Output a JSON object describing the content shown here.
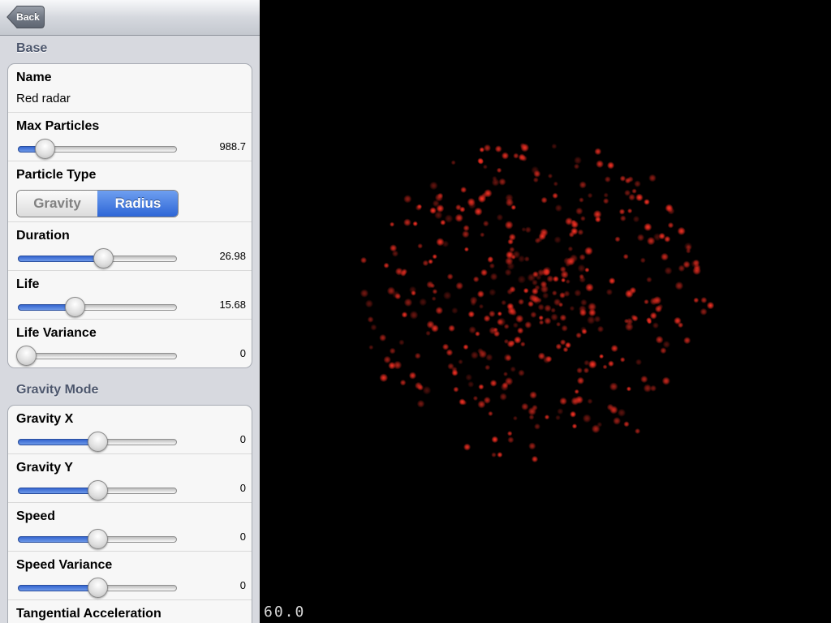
{
  "nav": {
    "back_label": "Back"
  },
  "sections": [
    {
      "title": "Base"
    },
    {
      "title": "Gravity Mode"
    }
  ],
  "base": {
    "name": {
      "label": "Name",
      "value": "Red radar"
    },
    "max_particles": {
      "label": "Max Particles",
      "value": "988.7",
      "fraction": 0.13
    },
    "particle_type": {
      "label": "Particle Type",
      "options": [
        "Gravity",
        "Radius"
      ],
      "selected": "Radius"
    },
    "duration": {
      "label": "Duration",
      "value": "26.98",
      "fraction": 0.54
    },
    "life": {
      "label": "Life",
      "value": "15.68",
      "fraction": 0.34
    },
    "life_variance": {
      "label": "Life Variance",
      "value": "0",
      "fraction": 0.0
    }
  },
  "gravity_mode": {
    "gravity_x": {
      "label": "Gravity X",
      "value": "0",
      "fraction": 0.5
    },
    "gravity_y": {
      "label": "Gravity Y",
      "value": "0",
      "fraction": 0.5
    },
    "speed": {
      "label": "Speed",
      "value": "0",
      "fraction": 0.5
    },
    "speed_variance": {
      "label": "Speed Variance",
      "value": "0",
      "fraction": 0.5
    },
    "tangential_acceleration": {
      "label": "Tangential Acceleration"
    }
  },
  "preview": {
    "fps": "60.0",
    "particle_color": "#e0291e",
    "background": "#000000"
  },
  "colors": {
    "accent": "#3a6fd8",
    "sidebar_bg": "#d7d9df",
    "section_title": "#4c566c"
  }
}
